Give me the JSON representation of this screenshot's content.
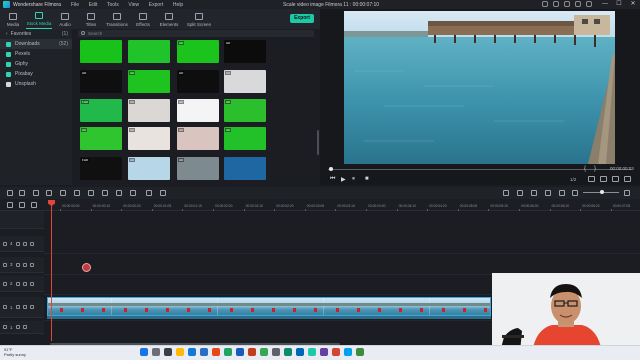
{
  "app": {
    "name": "Wondershare Filmora",
    "menu": [
      "File",
      "Edit",
      "Tools",
      "View",
      "Export",
      "Help"
    ],
    "document_title": "Scale video image Filmora 11 : 00:00:07:10",
    "window_controls": [
      "—",
      "☐",
      "✕"
    ]
  },
  "toolbar": {
    "items": [
      {
        "label": "Media",
        "active": false
      },
      {
        "label": "Stock Media",
        "active": true
      },
      {
        "label": "Audio",
        "active": false
      },
      {
        "label": "Titles",
        "active": false
      },
      {
        "label": "Transitions",
        "active": false
      },
      {
        "label": "Effects",
        "active": false
      },
      {
        "label": "Elements",
        "active": false
      },
      {
        "label": "Split Screen",
        "active": false
      }
    ],
    "export_label": "Export"
  },
  "sidebar": {
    "items": [
      {
        "label": "Favorites",
        "count": "(1)",
        "type": "group"
      },
      {
        "label": "Downloads",
        "count": "(52)",
        "type": "item",
        "selected": true
      },
      {
        "label": "Pexels",
        "count": "",
        "type": "item"
      },
      {
        "label": "Giphy",
        "count": "",
        "type": "item"
      },
      {
        "label": "Pixabay",
        "count": "",
        "type": "item"
      },
      {
        "label": "Unsplash",
        "count": "",
        "type": "item"
      }
    ]
  },
  "media": {
    "search_placeholder": "Search",
    "thumbs": [
      {
        "bg": "#18c21b",
        "badge": ""
      },
      {
        "bg": "#20c42a",
        "badge": ""
      },
      {
        "bg": "#1bc41d",
        "badge": "HD"
      },
      {
        "bg": "#0c0c0c",
        "badge": "HD"
      },
      {
        "bg": "#0f0f10",
        "badge": "HD"
      },
      {
        "bg": "#1fc31f",
        "badge": "HD"
      },
      {
        "bg": "#0e0e0e",
        "badge": "HD"
      },
      {
        "bg": "#d9d9dc",
        "badge": "HD"
      },
      {
        "bg": "#22b94b",
        "badge": "FHD"
      },
      {
        "bg": "#dad7d4",
        "badge": "HD"
      },
      {
        "bg": "#f4f4f4",
        "badge": "HD"
      },
      {
        "bg": "#2bbf2d",
        "badge": "HD"
      },
      {
        "bg": "#2ec52e",
        "badge": "HD"
      },
      {
        "bg": "#e8e3de",
        "badge": "HD"
      },
      {
        "bg": "#d9c4c0",
        "badge": "HD"
      },
      {
        "bg": "#22c12a",
        "badge": "HD"
      },
      {
        "bg": "#101010",
        "badge": "FHD"
      },
      {
        "bg": "#b7d6e8",
        "badge": "HD"
      },
      {
        "bg": "#7d8a90",
        "badge": "HD"
      },
      {
        "bg": "#1e67a3",
        "badge": ""
      }
    ]
  },
  "preview": {
    "timecode": "00:00:00:03",
    "ratio": "1/2"
  },
  "timeline": {
    "ruler": [
      "00:00:00:00",
      "00:00:00:10",
      "00:00:00:20",
      "00:00:01:05",
      "00:00:01:15",
      "00:00:02:00",
      "00:00:02:10",
      "00:00:02:20",
      "00:00:03:05",
      "00:00:03:15",
      "00:00:04:00",
      "00:00:04:10",
      "00:00:04:20",
      "00:00:05:05",
      "00:00:05:15",
      "00:00:06:00",
      "00:00:06:10",
      "00:00:06:20",
      "00:00:07:05",
      "00:00:07:15"
    ],
    "tracks": [
      "4",
      "3",
      "2",
      "1",
      "1"
    ]
  },
  "taskbar": {
    "weather_temp": "91°F",
    "weather_desc": "Partly sunny"
  }
}
